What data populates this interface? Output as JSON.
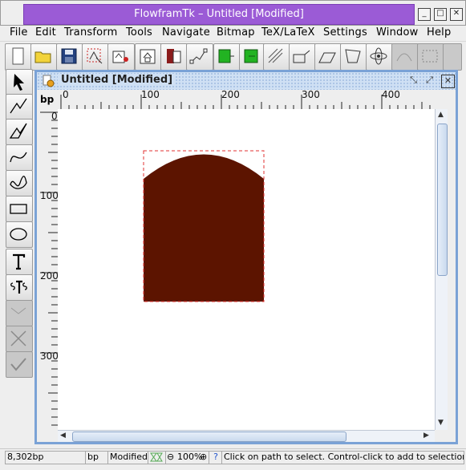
{
  "window": {
    "title": "FlowframTk – Untitled [Modified]",
    "controls": [
      "_",
      "□",
      "✕"
    ]
  },
  "menubar": [
    {
      "label": "File"
    },
    {
      "label": "Edit"
    },
    {
      "label": "Transform"
    },
    {
      "label": "Tools"
    },
    {
      "label": "Navigate"
    },
    {
      "label": "Bitmap"
    },
    {
      "label": "TeX/LaTeX"
    },
    {
      "label": "Settings"
    },
    {
      "label": "Window"
    },
    {
      "label": "Help"
    }
  ],
  "toolbar_icons": [
    "new-file-icon",
    "open-folder-icon",
    "save-icon",
    "select-all-icon",
    "group-icon",
    "ungroup-icon",
    "move-to-front-icon",
    "move-to-back-icon",
    "edit-path-icon",
    "green-connect-icon",
    "green-box-icon",
    "reduce-to-grid-icon",
    "rotate-icon",
    "scale-icon",
    "shear-icon",
    "atom-icon",
    "disabled-tool-icon",
    "disabled-selection-icon"
  ],
  "tools_icons": [
    "select-arrow-icon",
    "open-line-icon",
    "closed-line-icon",
    "open-curve-icon",
    "closed-curve-icon",
    "rectangle-icon",
    "ellipse-icon",
    "text-icon",
    "math-text-icon",
    "disabled-line-icon",
    "disabled-cross-icon",
    "disabled-check-icon"
  ],
  "document": {
    "title": "Untitled [Modified]",
    "icon": "document-gear-icon",
    "unit": "bp",
    "h_ruler_labels": [
      "0",
      "100",
      "200",
      "300",
      "400"
    ],
    "v_ruler_labels": [
      "0",
      "100",
      "200",
      "300"
    ]
  },
  "shape": {
    "fill": "#5c1400",
    "selection_color": "#e03030"
  },
  "statusbar": {
    "position": "8,302bp",
    "unit": "bp",
    "modified": "Modified",
    "zoom": "100%",
    "message": "Click on path to select. Control-click to add to selection. Doub"
  }
}
